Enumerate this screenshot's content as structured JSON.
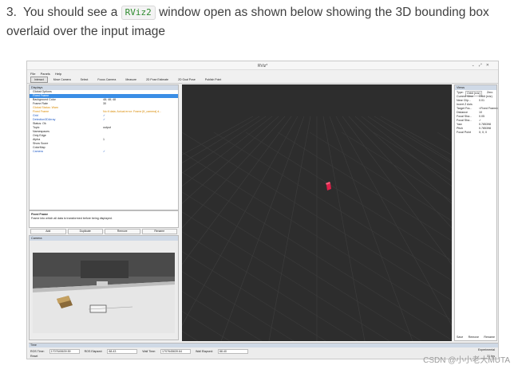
{
  "instruction": {
    "number": "3.",
    "before": "You should see a",
    "code": "RViz2",
    "after": "window open as shown below showing the 3D bounding box overlaid over the input image"
  },
  "rviz": {
    "window_title": "RViz*",
    "menu": [
      "File",
      "Panels",
      "Help"
    ],
    "toolbar": [
      "Interact",
      "Move Camera",
      "Select",
      "Focus Camera",
      "Measure",
      "2D Pose Estimate",
      "2D Goal Pose",
      "Publish Point"
    ],
    "displays": {
      "header": "Displays",
      "rows": [
        {
          "k": "Global Options",
          "v": "",
          "style": ""
        },
        {
          "k": "Fixed Frame",
          "v": "",
          "style": "sel"
        },
        {
          "k": "Background Color",
          "v": "48; 48; 48",
          "style": ""
        },
        {
          "k": "Frame Rate",
          "v": "30",
          "style": ""
        },
        {
          "k": "Global Status: Warn",
          "v": "",
          "style": "orange"
        },
        {
          "k": "Fixed Frame",
          "v": "No tf data. Actual error: Frame [tf_camera] d...",
          "style": "orange"
        },
        {
          "k": "Grid",
          "v": "✓",
          "style": "blue"
        },
        {
          "k": "Detection3DArray",
          "v": "✓",
          "style": "blue"
        },
        {
          "k": "Status: Ok",
          "v": "",
          "style": ""
        },
        {
          "k": "Topic",
          "v": "output",
          "style": ""
        },
        {
          "k": "Namespaces",
          "v": "",
          "style": ""
        },
        {
          "k": "Only Edge",
          "v": "",
          "style": ""
        },
        {
          "k": "Alpha",
          "v": "1",
          "style": ""
        },
        {
          "k": "Show Score",
          "v": "",
          "style": ""
        },
        {
          "k": "ColorMap",
          "v": "",
          "style": ""
        },
        {
          "k": "Camera",
          "v": "✓",
          "style": "blue"
        }
      ],
      "desc_title": "Fixed Frame",
      "desc_text": "Frame into which all data is transformed before being displayed.",
      "buttons": [
        "Add",
        "Duplicate",
        "Remove",
        "Rename"
      ]
    },
    "camera_header": "Camera",
    "views": {
      "header": "Views",
      "type_label": "Type:",
      "type_value": "Orbit (rviz)",
      "zero": "Zero",
      "rows": [
        {
          "k": "Current View",
          "v": "Orbit (rviz)"
        },
        {
          "k": "Near Clip...",
          "v": "0.01"
        },
        {
          "k": "Invert Z Axis",
          "v": ""
        },
        {
          "k": "Target Fra...",
          "v": "<Fixed Frame>"
        },
        {
          "k": "Distance",
          "v": "10"
        },
        {
          "k": "Focal Sha...",
          "v": "0.05"
        },
        {
          "k": "Focal Sha...",
          "v": "✓"
        },
        {
          "k": "Yaw",
          "v": "0.785398"
        },
        {
          "k": "Pitch",
          "v": "0.785398"
        },
        {
          "k": "Focal Point",
          "v": "0; 0; 0"
        }
      ],
      "buttons": [
        "Save",
        "Remove",
        "Rename"
      ]
    },
    "time": {
      "header": "Time",
      "ros_time_label": "ROS Time:",
      "ros_time": "1707645639.59",
      "ros_elapsed_label": "ROS Elapsed:",
      "ros_elapsed": "88.43",
      "wall_time_label": "Wall Time:",
      "wall_time": "1707645639.64",
      "wall_elapsed_label": "Wall Elapsed:",
      "wall_elapsed": "88.40",
      "reset": "Reset",
      "experimental": "Experimental",
      "fps": "31 fps"
    }
  },
  "watermark": "CSDN @小小老大MUTA"
}
